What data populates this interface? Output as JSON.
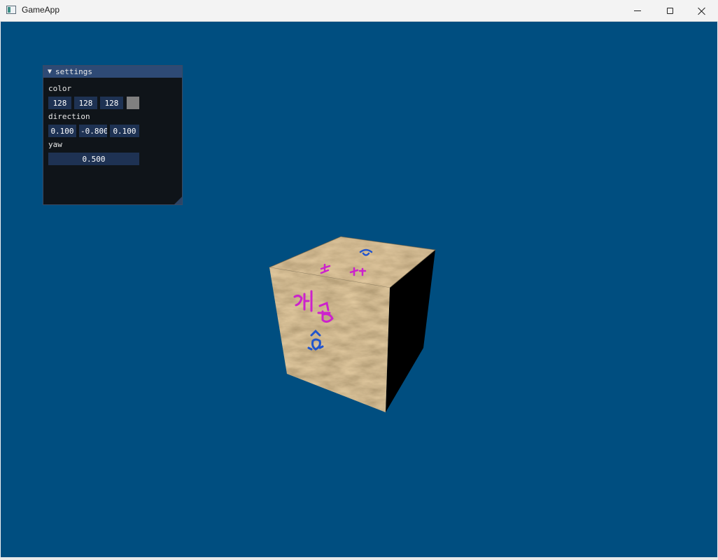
{
  "window": {
    "title": "GameApp",
    "icon": "app-window-icon"
  },
  "controls": {
    "minimize_icon": "minimize-icon",
    "maximize_icon": "maximize-icon",
    "close_icon": "close-icon"
  },
  "viewport": {
    "background": "#004e80"
  },
  "settings_panel": {
    "title": "settings",
    "collapse_glyph": "▼",
    "color_label": "color",
    "color_values": [
      "128",
      "128",
      "128"
    ],
    "swatch_color": "#808080",
    "direction_label": "direction",
    "direction_values": [
      "0.100",
      "-0.800",
      "0.100"
    ],
    "yaw_label": "yaw",
    "yaw_value": "0.500"
  },
  "scene": {
    "object": "textured-wooden-cube",
    "graffiti": [
      "해섭",
      "독 바",
      "^_^"
    ]
  }
}
